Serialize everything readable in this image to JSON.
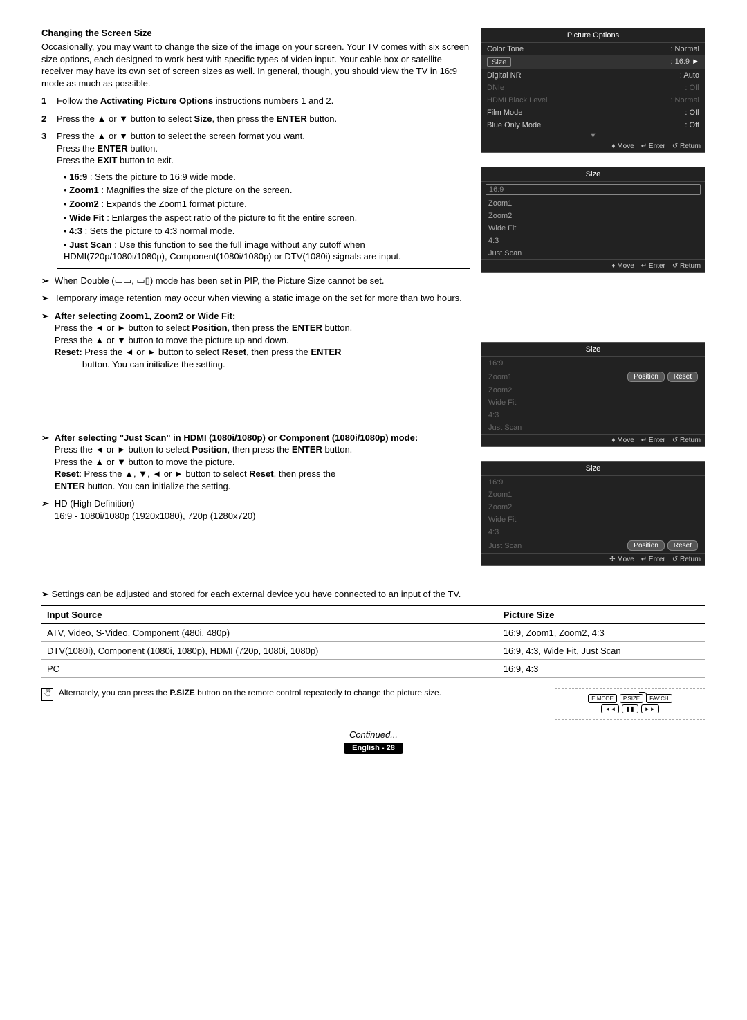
{
  "heading": "Changing the Screen Size",
  "intro": "Occasionally, you may want to change the size of the image on your screen. Your TV comes with six screen size options, each designed to work best with specific types of video input. Your cable box or satellite receiver may have its own set of screen sizes as well. In general, though, you should view the TV in 16:9 mode as much as possible.",
  "steps": {
    "s1_pre": "Follow the ",
    "s1_b": "Activating Picture Options",
    "s1_post": " instructions numbers 1 and 2.",
    "s2_pre": "Press the ▲ or ▼ button to select ",
    "s2_b1": "Size",
    "s2_mid": ", then press the ",
    "s2_b2": "ENTER",
    "s2_post": " button.",
    "s3_l1": "Press the ▲ or ▼ button to select the screen format you want.",
    "s3_l2a": "Press the ",
    "s3_l2b": "ENTER",
    "s3_l2c": " button.",
    "s3_l3a": "Press the ",
    "s3_l3b": "EXIT",
    "s3_l3c": " button to exit."
  },
  "bullets": [
    {
      "b": "16:9",
      "t": " : Sets the picture to 16:9 wide mode."
    },
    {
      "b": "Zoom1",
      "t": " : Magnifies the size of the picture on the screen."
    },
    {
      "b": "Zoom2",
      "t": " : Expands the Zoom1 format picture."
    },
    {
      "b": "Wide Fit",
      "t": " : Enlarges the aspect ratio of the picture to fit the entire screen."
    },
    {
      "b": "4:3",
      "t": " : Sets the picture to 4:3 normal mode."
    },
    {
      "b": "Just Scan",
      "t": " : Use this function to see the full image without any cutoff when HDMI(720p/1080i/1080p), Component(1080i/1080p) or DTV(1080i) signals are input."
    }
  ],
  "notes": {
    "pip": "When Double (▭▭, ▭▯) mode has been set in PIP, the Picture Size cannot be set.",
    "retention": "Temporary image retention may occur when viewing a static image on the set for more than two hours.",
    "zoomTitle": "After selecting Zoom1, Zoom2 or Wide Fit",
    "zoom_l1": "Press the ◄ or ► button to select Position, then press the ENTER button.",
    "zoom_l2": "Press the ▲ or ▼ button to move the picture up and down.",
    "zoom_l3": "Reset: Press the ◄ or ► button to select Reset, then press the ENTER button. You can initialize the setting.",
    "jsTitle": "After selecting \"Just Scan\" in HDMI (1080i/1080p) or Component (1080i/1080p) mode",
    "js_l1": "Press the ◄ or ► button to select Position, then press the ENTER button.",
    "js_l2": "Press the ▲ or ▼ button to move the picture.",
    "js_l3": "Reset: Press the  ▲, ▼, ◄ or ► button to select Reset, then press the ENTER button. You can initialize the setting.",
    "hd1": "HD (High Definition)",
    "hd2": "16:9 - 1080i/1080p (1920x1080), 720p (1280x720)",
    "stored": "Settings can be adjusted and stored for each external device you have connected to an input of the TV."
  },
  "osd": {
    "po_title": "Picture Options",
    "po_rows": [
      {
        "l": "Color Tone",
        "v": ": Normal",
        "dim": false,
        "sel": false
      },
      {
        "l": "Size",
        "v": ": 16:9",
        "dim": false,
        "sel": true
      },
      {
        "l": "Digital NR",
        "v": ": Auto",
        "dim": false,
        "sel": false
      },
      {
        "l": "DNIe",
        "v": ": Off",
        "dim": true,
        "sel": false
      },
      {
        "l": "HDMI Black Level",
        "v": ": Normal",
        "dim": true,
        "sel": false
      },
      {
        "l": "Film Mode",
        "v": ": Off",
        "dim": false,
        "sel": false
      },
      {
        "l": "Blue Only Mode",
        "v": ": Off",
        "dim": false,
        "sel": false
      }
    ],
    "foot_move": "♦ Move",
    "foot_enter": "↵ Enter",
    "foot_return": "↺ Return",
    "foot_move4": "✢ Move",
    "size_title": "Size",
    "size_items": [
      "16:9",
      "Zoom1",
      "Zoom2",
      "Wide Fit",
      "4:3",
      "Just Scan"
    ],
    "pos": "Position",
    "reset": "Reset"
  },
  "table": {
    "h1": "Input Source",
    "h2": "Picture Size",
    "rows": [
      {
        "a": "ATV, Video, S-Video, Component (480i, 480p)",
        "b": "16:9, Zoom1, Zoom2, 4:3"
      },
      {
        "a": "DTV(1080i), Component (1080i, 1080p), HDMI (720p, 1080i, 1080p)",
        "b": "16:9, 4:3, Wide Fit, Just Scan"
      },
      {
        "a": "PC",
        "b": "16:9, 4:3"
      }
    ]
  },
  "remoteHint": "Alternately, you can press the P.SIZE button on the remote control repeatedly to change the picture size.",
  "remote": {
    "b1": "E.MODE",
    "b2": "P.SIZE",
    "b3": "FAV.CH",
    "b4": "◄◄",
    "b5": "❚❚",
    "b6": "►►"
  },
  "continued": "Continued...",
  "pagefoot": "English - 28"
}
